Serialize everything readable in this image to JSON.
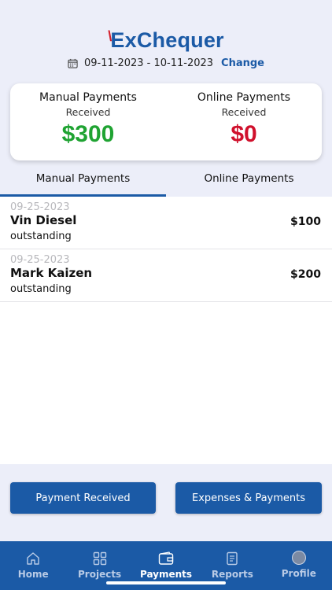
{
  "app": {
    "logo_text": "ExChequer",
    "logo_tick": "\\"
  },
  "date_range": {
    "text": "09-11-2023 - 10-11-2023",
    "change_label": "Change"
  },
  "summary": {
    "manual": {
      "title": "Manual Payments",
      "subtitle": "Received",
      "amount": "$300"
    },
    "online": {
      "title": "Online Payments",
      "subtitle": "Received",
      "amount": "$0"
    }
  },
  "tabs": [
    {
      "label": "Manual Payments",
      "active": true
    },
    {
      "label": "Online Payments",
      "active": false
    }
  ],
  "payments": [
    {
      "date": "09-25-2023",
      "name": "Vin Diesel",
      "status": "outstanding",
      "amount": "$100"
    },
    {
      "date": "09-25-2023",
      "name": "Mark Kaizen",
      "status": "outstanding",
      "amount": "$200"
    }
  ],
  "actions": {
    "payment_received": "Payment Received",
    "expenses_payments": "Expenses & Payments"
  },
  "nav": [
    {
      "label": "Home",
      "icon": "home-icon"
    },
    {
      "label": "Projects",
      "icon": "grid-icon"
    },
    {
      "label": "Payments",
      "icon": "wallet-icon",
      "active": true
    },
    {
      "label": "Reports",
      "icon": "report-icon"
    },
    {
      "label": "Profile",
      "icon": "avatar"
    }
  ],
  "colors": {
    "brand": "#1b5aa6",
    "positive": "#1fa332",
    "negative": "#d0102c",
    "background": "#eceef9"
  }
}
